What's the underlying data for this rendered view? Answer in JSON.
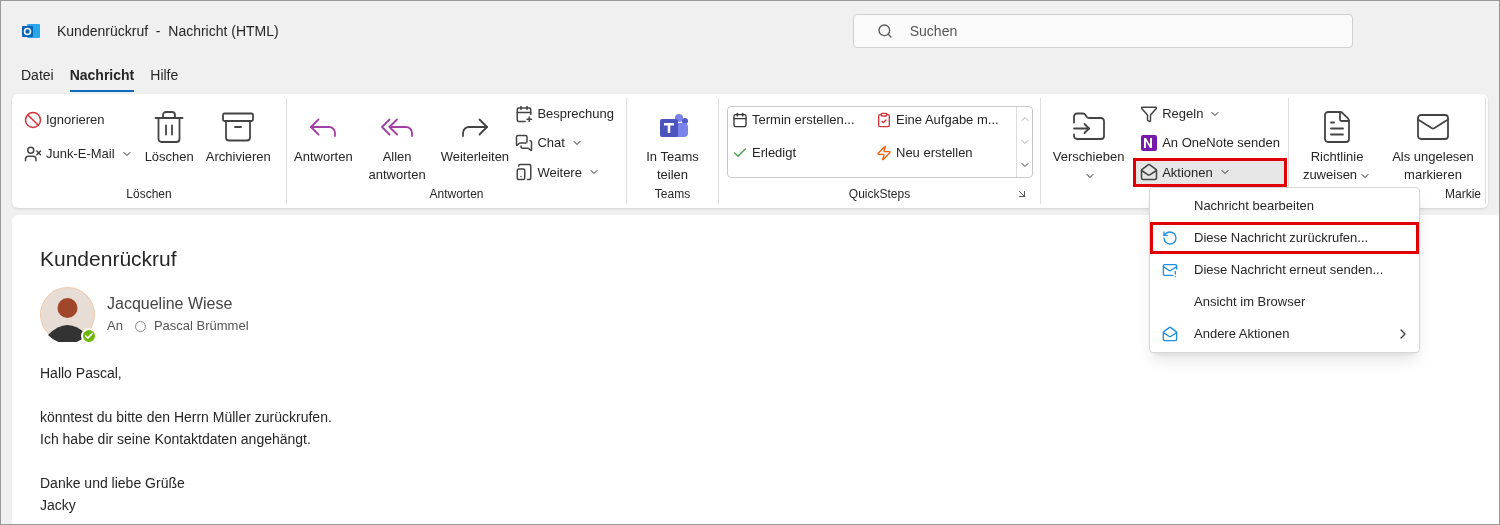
{
  "window": {
    "title": "Kundenrückruf  -  Nachricht (HTML)"
  },
  "search": {
    "placeholder": "Suchen"
  },
  "tabs": [
    {
      "label": "Datei",
      "selected": false
    },
    {
      "label": "Nachricht",
      "selected": true
    },
    {
      "label": "Hilfe",
      "selected": false
    }
  ],
  "ribbon": {
    "groups": [
      {
        "label": "Löschen",
        "columns": [
          {
            "kind": "stack",
            "buttons": [
              {
                "label": "Ignorieren",
                "dropdown": false
              },
              {
                "label": "Junk-E-Mail",
                "dropdown": true
              }
            ]
          },
          {
            "kind": "large",
            "label": "Löschen",
            "dropdown": false
          },
          {
            "kind": "large",
            "label": "Archivieren",
            "dropdown": false
          }
        ]
      },
      {
        "label": "Antworten",
        "columns": [
          {
            "kind": "large",
            "label": "Antworten",
            "dropdown": false
          },
          {
            "kind": "large",
            "label": "Allen antworten",
            "dropdown": false
          },
          {
            "kind": "large",
            "label": "Weiterleiten",
            "dropdown": false
          },
          {
            "kind": "stack",
            "buttons": [
              {
                "label": "Besprechung",
                "dropdown": false
              },
              {
                "label": "Chat",
                "dropdown": true
              },
              {
                "label": "Weitere",
                "dropdown": true
              }
            ]
          }
        ]
      },
      {
        "label": "Teams",
        "columns": [
          {
            "kind": "large",
            "label": "In Teams teilen",
            "dropdown": false
          }
        ]
      },
      {
        "label": "QuickSteps",
        "launcher": true,
        "columns": [
          {
            "kind": "gallery",
            "items": [
              "Termin erstellen...",
              "Eine Aufgabe m...",
              "Erledigt",
              "Neu erstellen"
            ]
          }
        ]
      },
      {
        "columns": [
          {
            "kind": "large",
            "label": "Verschieben",
            "dropdown": true
          },
          {
            "kind": "stack",
            "buttons": [
              {
                "label": "Regeln",
                "dropdown": true
              },
              {
                "label": "An OneNote senden",
                "dropdown": false
              },
              {
                "label": "Aktionen",
                "dropdown": true,
                "highlighted": true
              }
            ]
          }
        ]
      },
      {
        "label": "Markie",
        "columns": [
          {
            "kind": "large",
            "label": "Richtlinie zuweisen",
            "dropdown": true
          },
          {
            "kind": "large",
            "label": "Als ungelesen markieren",
            "dropdown": false
          }
        ]
      }
    ]
  },
  "actions_menu": {
    "items": [
      {
        "label": "Nachricht bearbeiten",
        "highlighted": false,
        "submenu": false
      },
      {
        "label": "Diese Nachricht zurückrufen...",
        "highlighted": true,
        "submenu": false
      },
      {
        "label": "Diese Nachricht erneut senden...",
        "highlighted": false,
        "submenu": false
      },
      {
        "label": "Ansicht im Browser",
        "highlighted": false,
        "submenu": false
      },
      {
        "label": "Andere Aktionen",
        "highlighted": false,
        "submenu": true
      }
    ]
  },
  "message": {
    "subject": "Kundenrückruf",
    "sender": "Jacqueline Wiese",
    "sender_online": true,
    "to_label": "An",
    "recipient": "Pascal Brümmel",
    "paragraphs": [
      [
        "Hallo Pascal,"
      ],
      [
        "könntest du bitte den Herrn Müller zurückrufen.",
        "Ich habe dir seine Kontaktdaten angehängt."
      ],
      [
        "Danke und liebe Grüße",
        "Jacky"
      ]
    ]
  }
}
